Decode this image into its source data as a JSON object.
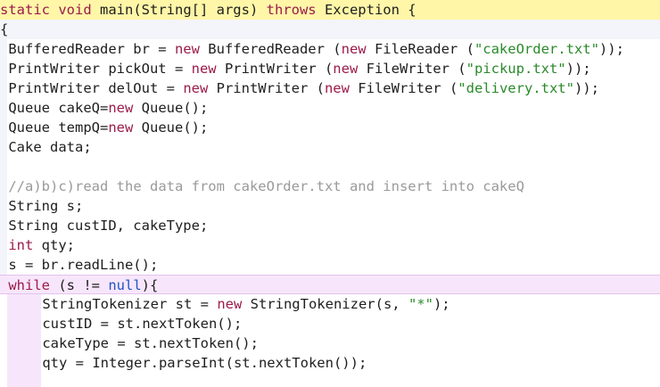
{
  "code": {
    "lines": [
      "static void main(String[] args) throws Exception {",
      "{",
      "BufferedReader br = new BufferedReader (new FileReader (\"cakeOrder.txt\"));",
      "PrintWriter pickOut = new PrintWriter (new FileWriter (\"pickup.txt\"));",
      "PrintWriter delOut = new PrintWriter (new FileWriter (\"delivery.txt\"));",
      "Queue cakeQ=new Queue();",
      "Queue tempQ=new Queue();",
      "Cake data;",
      "",
      "//a)b)c)read the data from cakeOrder.txt and insert into cakeQ",
      "String s;",
      "String custID, cakeType;",
      "int qty;",
      "s = br.readLine();",
      "while (s != null){",
      "StringTokenizer st = new StringTokenizer(s, \"*\");",
      "custID = st.nextToken();",
      "cakeType = st.nextToken();",
      "qty = Integer.parseInt(st.nextToken());"
    ]
  },
  "colors": {
    "keyword": "#9b1b4a",
    "string": "#2b8a2b",
    "comment": "#9a9a9a",
    "literal": "#1f56c4",
    "current_line_highlight": "#fff6a8",
    "block_highlight": "#f7e6fb"
  }
}
